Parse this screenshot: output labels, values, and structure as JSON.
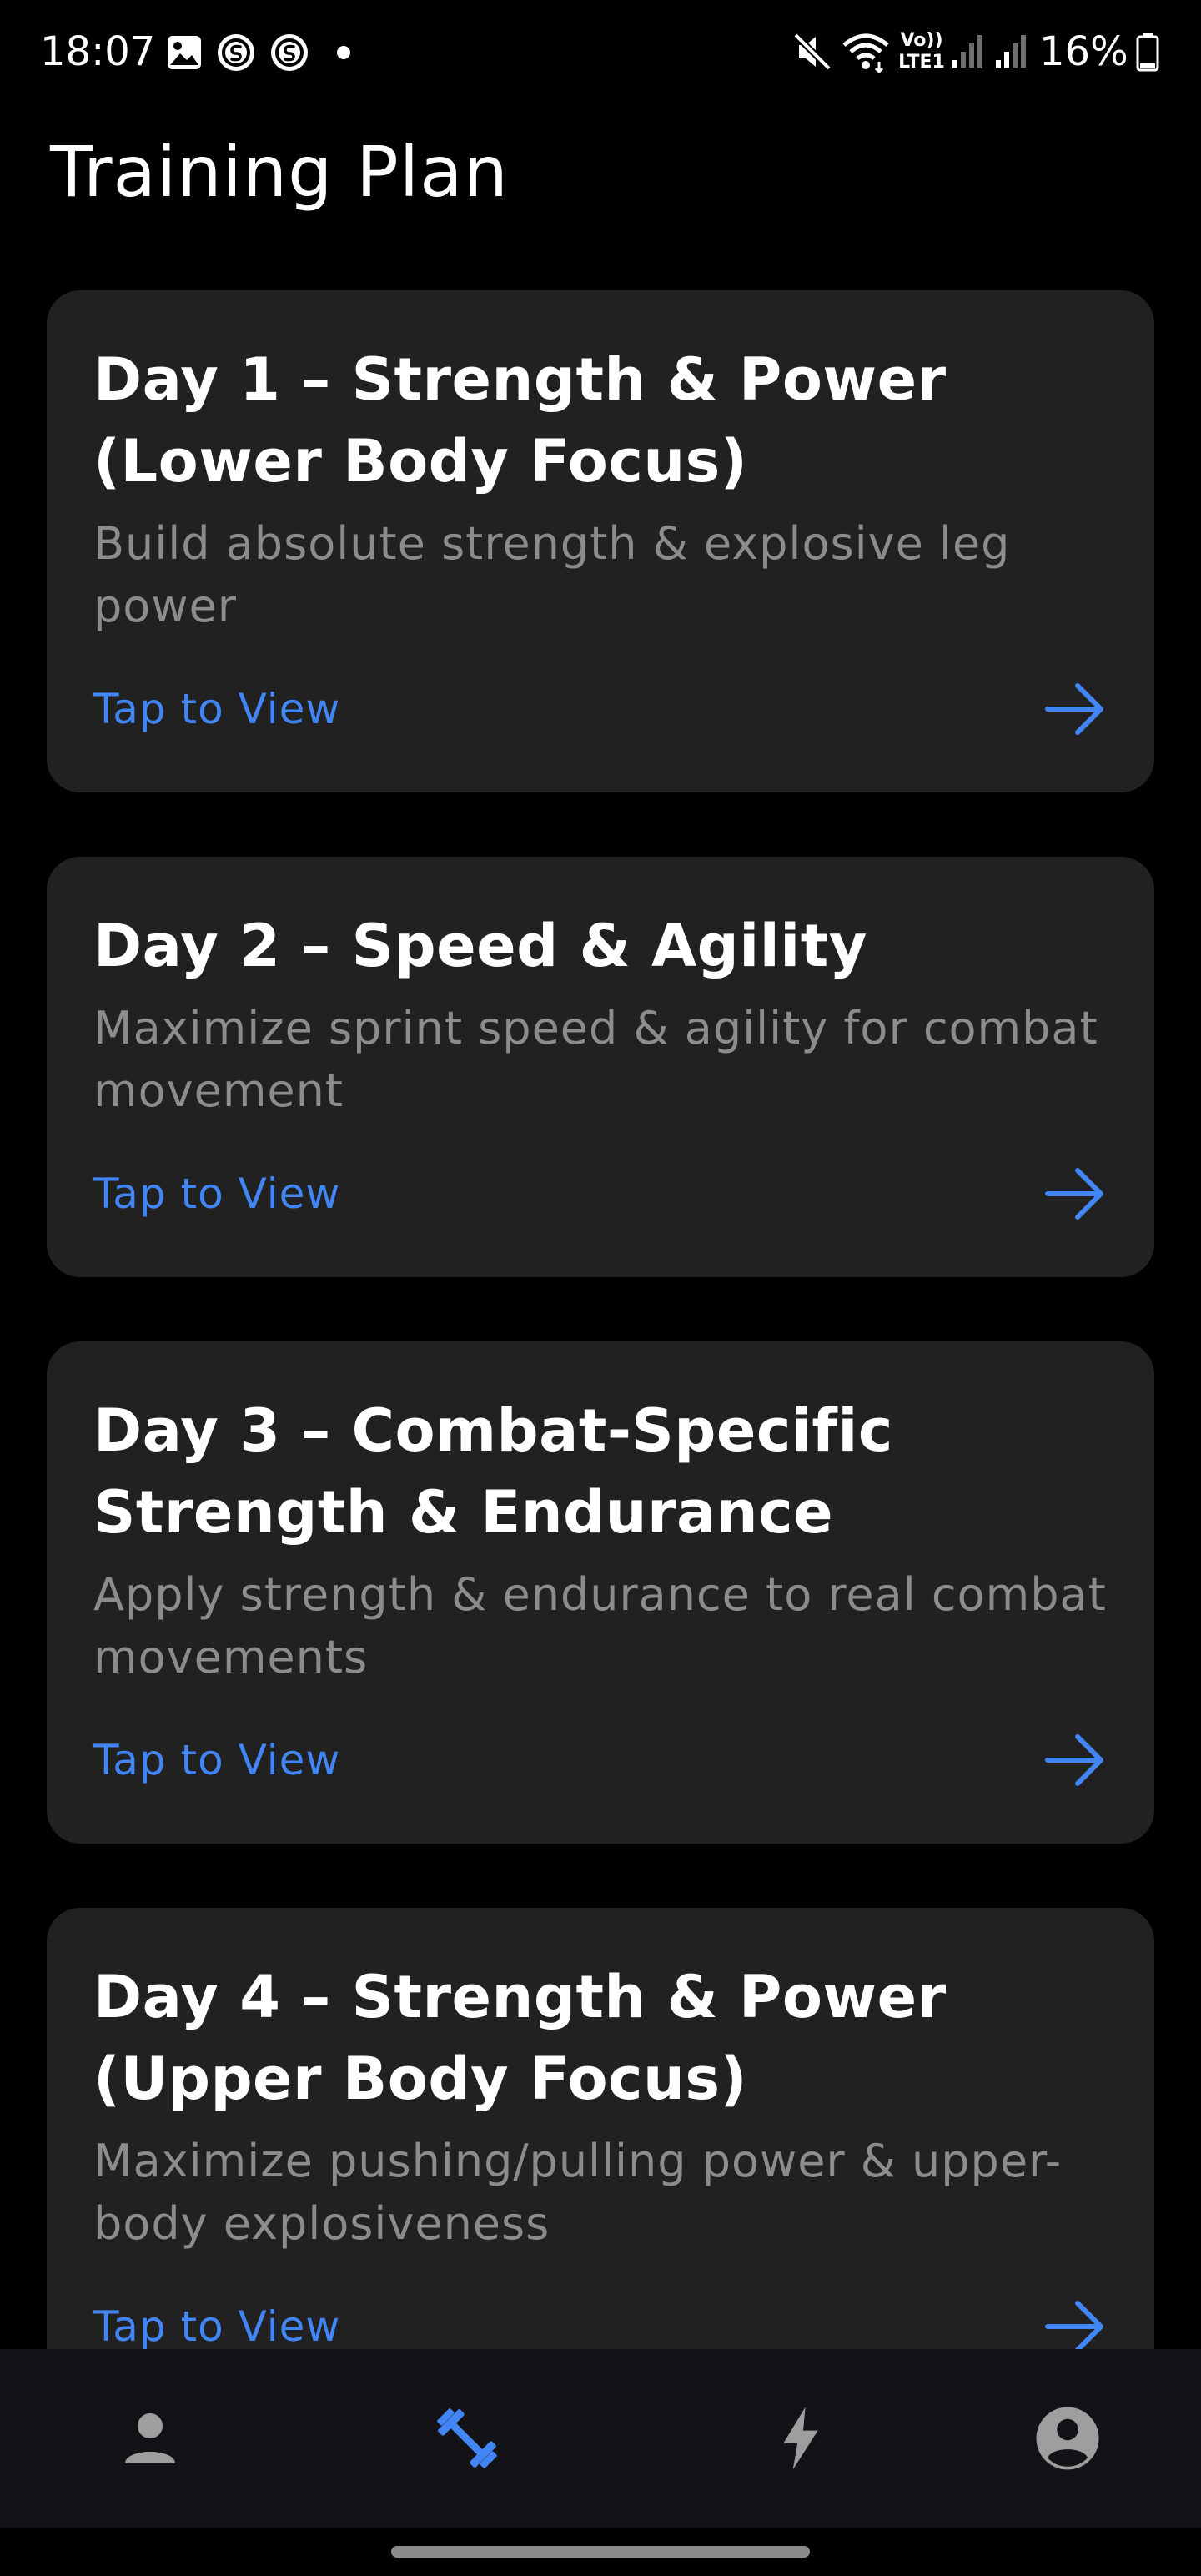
{
  "status_bar": {
    "time": "18:07",
    "notification_icons": [
      "gallery-icon",
      "s-app-icon",
      "s-app-icon",
      "dot-icon"
    ],
    "right_icons": [
      "mute-icon",
      "wifi-icon",
      "volte-icon",
      "signal-icon",
      "signal-icon",
      "battery-icon"
    ],
    "volte_label_top": "Vo))",
    "volte_label_bottom": "LTE1",
    "battery": "16%"
  },
  "page": {
    "title": "Training Plan"
  },
  "cards": [
    {
      "title": "Day 1 – Strength & Power (Lower Body Focus)",
      "description": "Build absolute strength & explosive leg power",
      "cta": "Tap to View"
    },
    {
      "title": "Day 2 – Speed & Agility",
      "description": "Maximize sprint speed & agility for combat movement",
      "cta": "Tap to View"
    },
    {
      "title": "Day 3 – Combat-Specific Strength & Endurance",
      "description": "Apply strength & endurance to real combat movements",
      "cta": "Tap to View"
    },
    {
      "title": "Day 4 – Strength & Power (Upper Body Focus)",
      "description": "Maximize pushing/pulling power & upper-body explosiveness",
      "cta": "Tap to View"
    }
  ],
  "bottom_nav": {
    "items": [
      {
        "icon": "person-icon",
        "active": false
      },
      {
        "icon": "dumbbell-icon",
        "active": true
      },
      {
        "icon": "lightning-icon",
        "active": false
      },
      {
        "icon": "account-circle-icon",
        "active": false
      }
    ]
  },
  "colors": {
    "background": "#000000",
    "card": "#212121",
    "accent": "#4285f4",
    "muted_text": "#8c8c8c",
    "nav_background": "#121217",
    "nav_inactive": "#9e9e9e"
  }
}
